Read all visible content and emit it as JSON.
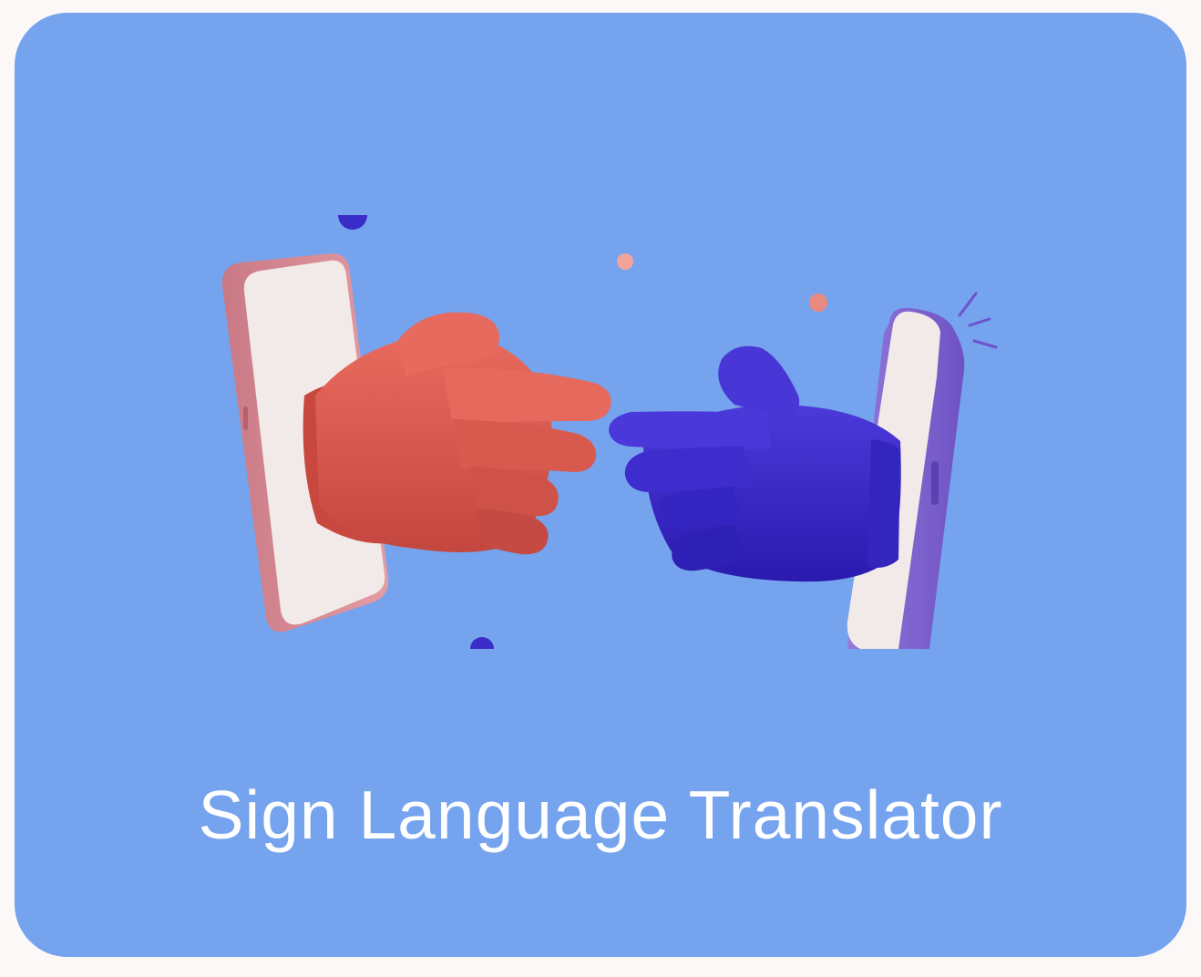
{
  "card": {
    "title": "Sign Language Translator",
    "background_color": "#75A3EE"
  },
  "illustration": {
    "left_hand": "pointing-hand-icon",
    "right_hand": "pointing-hand-icon",
    "left_phone": "smartphone-icon",
    "right_phone": "smartphone-icon",
    "colors": {
      "left_hand": "#D2564C",
      "right_hand": "#3A28C4",
      "left_phone_frame": "#D78A93",
      "right_phone_frame": "#8066D0",
      "phone_screen": "#F1EAE8"
    }
  }
}
